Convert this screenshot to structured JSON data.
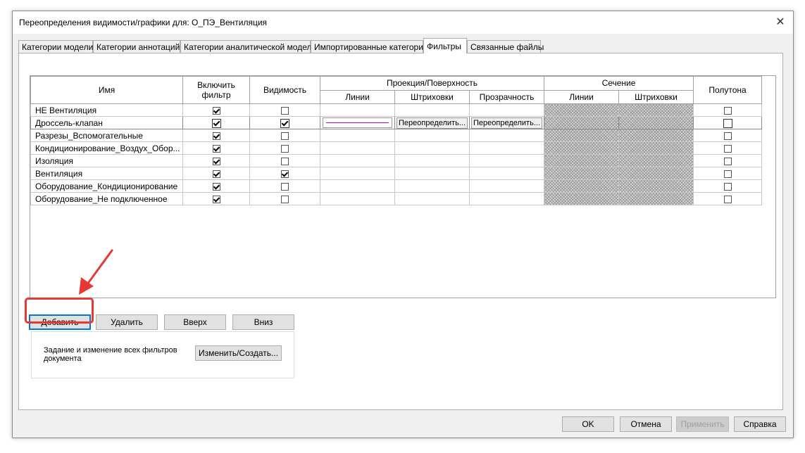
{
  "window": {
    "title": "Переопределения видимости/графики для: О_ПЭ_Вентиляция",
    "close_glyph": "✕"
  },
  "tabs": [
    {
      "label": "Категории модели"
    },
    {
      "label": "Категории аннотаций"
    },
    {
      "label": "Категории аналитической модели"
    },
    {
      "label": "Импортированные категории"
    },
    {
      "label": "Фильтры"
    },
    {
      "label": "Связанные файлы"
    }
  ],
  "active_tab": "Фильтры",
  "table": {
    "headers": {
      "name": "Имя",
      "enable": "Включить фильтр",
      "visibility": "Видимость",
      "projection": "Проекция/Поверхность",
      "proj_lines": "Линии",
      "proj_patterns": "Штриховки",
      "proj_transparency": "Прозрачность",
      "cut": "Сечение",
      "cut_lines": "Линии",
      "cut_patterns": "Штриховки",
      "halftone": "Полутона"
    },
    "rows": [
      {
        "name": "НЕ Вентиляция",
        "enable": true,
        "visible": false,
        "halftone": false
      },
      {
        "name": "Дроссель-клапан",
        "enable": true,
        "visible": true,
        "halftone": false,
        "selected": true,
        "pattern_btn": "Переопределить...",
        "transparency_btn": "Переопределить..."
      },
      {
        "name": "Разрезы_Вспомогательные",
        "enable": true,
        "visible": false,
        "halftone": false
      },
      {
        "name": "Кондиционирование_Воздух_Обор...",
        "enable": true,
        "visible": false,
        "halftone": false
      },
      {
        "name": "Изоляция",
        "enable": true,
        "visible": false,
        "halftone": false
      },
      {
        "name": "Вентиляция",
        "enable": true,
        "visible": true,
        "halftone": false
      },
      {
        "name": "Оборудование_Кондиционирование",
        "enable": true,
        "visible": false,
        "halftone": false
      },
      {
        "name": "Оборудование_Не подключенное",
        "enable": true,
        "visible": false,
        "halftone": false
      }
    ],
    "line_color": "#c000c0"
  },
  "buttons": {
    "add": "Добавить",
    "remove": "Удалить",
    "up": "Вверх",
    "down": "Вниз",
    "edit_create": "Изменить/Создать...",
    "ok": "OK",
    "cancel": "Отмена",
    "apply": "Применить",
    "help": "Справка"
  },
  "group": {
    "text": "Задание и изменение всех фильтров документа"
  },
  "annotation": {
    "color": "#e53935"
  }
}
